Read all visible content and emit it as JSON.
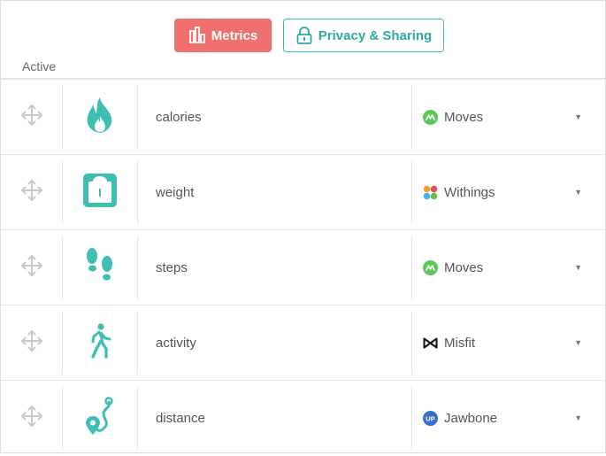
{
  "tabs": {
    "metrics_label": "Metrics",
    "privacy_label": "Privacy & Sharing"
  },
  "section": {
    "label": "Active"
  },
  "rows": [
    {
      "metric": "calories",
      "icon": "flame-icon",
      "source": "Moves",
      "source_logo": "moves-logo-icon"
    },
    {
      "metric": "weight",
      "icon": "scale-icon",
      "source": "Withings",
      "source_logo": "withings-logo-icon"
    },
    {
      "metric": "steps",
      "icon": "footprints-icon",
      "source": "Moves",
      "source_logo": "moves-logo-icon"
    },
    {
      "metric": "activity",
      "icon": "walking-person-icon",
      "source": "Misfit",
      "source_logo": "misfit-logo-icon"
    },
    {
      "metric": "distance",
      "icon": "route-pin-icon",
      "source": "Jawbone",
      "source_logo": "jawbone-logo-icon"
    }
  ],
  "colors": {
    "accent_red": "#f06f6f",
    "accent_teal": "#3fbfb4",
    "moves_green": "#5ac85a",
    "jawbone_blue": "#3a6fd0"
  }
}
